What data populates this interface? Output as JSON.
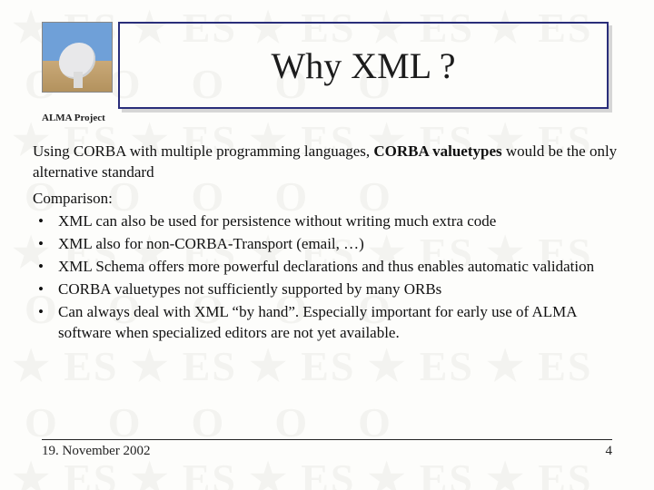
{
  "header": {
    "title": "Why XML ?",
    "project_label": "ALMA Project"
  },
  "body": {
    "intro_pre": "Using CORBA with multiple programming languages, ",
    "intro_bold": "CORBA valuetypes",
    "intro_post": " would be the only alternative standard",
    "compare_label": "Comparison:",
    "points": [
      "XML can also be used for persistence without writing much extra code",
      "XML also for non-CORBA-Transport (email, …)",
      "XML Schema offers more powerful declarations and thus enables automatic validation",
      "CORBA valuetypes not sufficiently supported by many ORBs",
      "Can always deal with XML “by hand”. Especially important for early use of ALMA software when specialized editors are not yet available."
    ]
  },
  "footer": {
    "date": "19. November 2002",
    "page": "4"
  },
  "watermark_row": " ★ ES ★ ES ★ ES ★ ES ★ ES\n  O    O    O    O    O\n ★ ES ★ ES ★ ES ★ ES ★ ES\n  O    O    O    O    O\n ★ ES ★ ES ★ ES ★ ES ★ ES\n  O    O    O    O    O\n ★ ES ★ ES ★ ES ★ ES ★ ES\n  O    O    O    O    O\n ★ ES ★ ES ★ ES ★ ES ★ ES"
}
